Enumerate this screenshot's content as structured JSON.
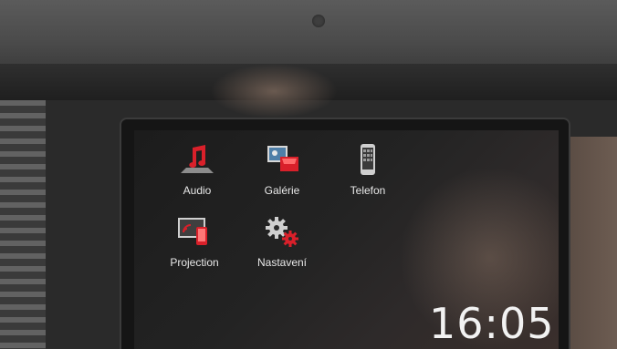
{
  "screen": {
    "apps": [
      {
        "label": "Audio",
        "icon": "music-note-icon"
      },
      {
        "label": "Galérie",
        "icon": "gallery-icon"
      },
      {
        "label": "Telefon",
        "icon": "phone-icon"
      },
      {
        "label": "Projection",
        "icon": "projection-icon"
      },
      {
        "label": "Nastavení",
        "icon": "gear-icon"
      }
    ],
    "clock": "16:05"
  },
  "colors": {
    "accent": "#d9202a",
    "text": "#e8e8e8"
  }
}
